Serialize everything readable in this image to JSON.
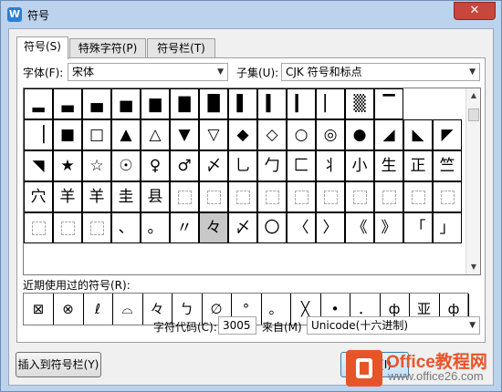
{
  "window": {
    "title": "符号",
    "app_icon": "W",
    "close_symbol": "✕"
  },
  "tabs": [
    {
      "label": "符号(S)"
    },
    {
      "label": "特殊字符(P)"
    },
    {
      "label": "符号栏(T)"
    }
  ],
  "font": {
    "label": "字体(F):",
    "value": "宋体"
  },
  "subset": {
    "label": "子集(U):",
    "value": "CJK 符号和标点"
  },
  "symbol_grid": [
    [
      "▂",
      "▃",
      "▄",
      "▅",
      "▆",
      "▇",
      "█",
      "▌",
      "▍",
      "▎",
      "▏",
      "▒",
      "▔"
    ],
    [
      "▕",
      "■",
      "□",
      "▲",
      "△",
      "▼",
      "▽",
      "◆",
      "◇",
      "○",
      "◎",
      "●",
      "◢",
      "◣",
      "◤"
    ],
    [
      "◥",
      "★",
      "☆",
      "☉",
      "♀",
      "♂",
      "〆",
      "乚",
      "勹",
      "匚",
      "丬",
      "小",
      "生",
      "正",
      "竺"
    ],
    [
      "穴",
      "羊",
      "羊",
      "圭",
      "县",
      "",
      "",
      "",
      "",
      "",
      "",
      "",
      "",
      "",
      ""
    ],
    [
      "",
      "",
      "",
      "、",
      "。",
      "〃",
      "々",
      "〆",
      "〇",
      "〈",
      "〉",
      "《",
      "》",
      "「",
      "」"
    ]
  ],
  "recent": {
    "label": "近期使用过的符号(R):",
    "items": [
      "⊠",
      "⊗",
      "ℓ",
      "⌓",
      "々",
      "ㄅ",
      "∅",
      "°",
      "。",
      "╳",
      "•",
      "．",
      "ф",
      "亚",
      "ф"
    ]
  },
  "char_code": {
    "label": "字符代码(C):",
    "value": "3005"
  },
  "from": {
    "label": "来自(M)",
    "value": "Unicode(十六进制)"
  },
  "buttons": {
    "insert_to_bar": "插入到符号栏(Y)",
    "insert": "插入(I)"
  },
  "watermark": {
    "line1": "Office教程网",
    "line2": "www.office26.com"
  },
  "colors": {
    "selected_cell": "#c8c8c8",
    "close_button": "#c7473a",
    "watermark_orange": "#e8542a"
  }
}
